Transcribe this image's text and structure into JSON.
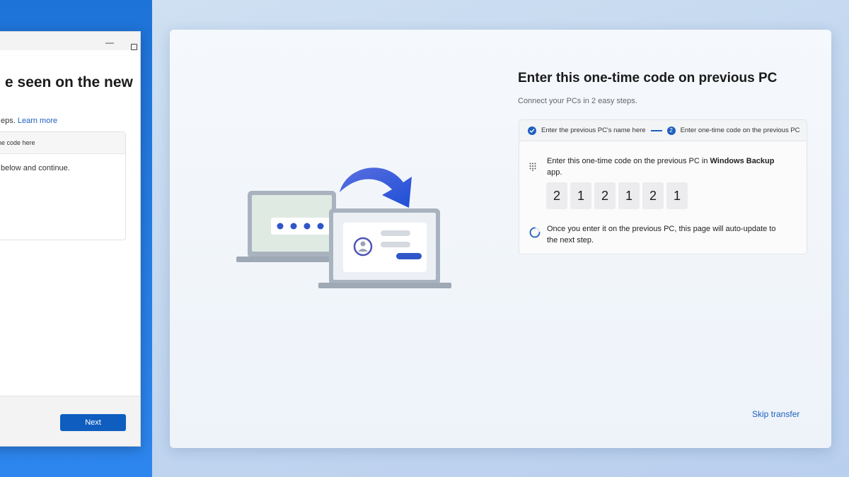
{
  "background_window": {
    "title_partial": "e seen on the new",
    "subtitle_partial": "eps.",
    "learn_more_label": "Learn more",
    "box_header_partial": "time code here",
    "box_text_partial": "C below and continue.",
    "next_label": "Next"
  },
  "dialog": {
    "heading": "Enter this one-time code on previous PC",
    "subheading": "Connect your PCs in 2 easy steps.",
    "steps": [
      {
        "label": "Enter the previous PC's name here",
        "state": "done"
      },
      {
        "number": "2",
        "label": "Enter one-time code on the previous PC",
        "state": "current"
      }
    ],
    "instruction_prefix": "Enter this one-time code on the previous PC in ",
    "instruction_app": "Windows Backup",
    "instruction_suffix": "app.",
    "code_digits": [
      "2",
      "1",
      "2",
      "1",
      "2",
      "1"
    ],
    "wait_text": "Once you enter it on the previous PC, this page will auto-update to the next step.",
    "skip_label": "Skip transfer"
  },
  "colors": {
    "accent": "#1f5fbf",
    "button_primary": "#0f5ebf",
    "desktop_blue": "#1e73d8"
  },
  "icons": [
    "check-icon",
    "keypad-icon",
    "spinner-icon",
    "transfer-arrow-icon"
  ]
}
